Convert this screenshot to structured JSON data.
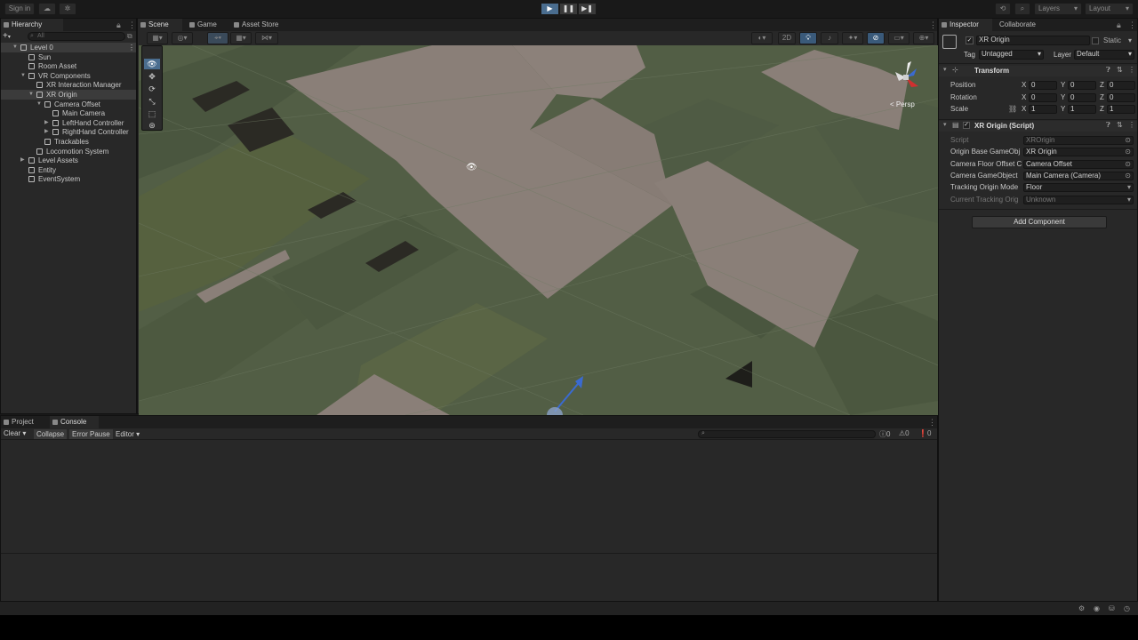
{
  "topbar": {
    "sign_in": "Sign in",
    "layers": "Layers",
    "layout": "Layout",
    "play": "▶",
    "pause": "❚❚",
    "step": "▶❚"
  },
  "hierarchy": {
    "tab": "Hierarchy",
    "search_placeholder": "All",
    "add": "+",
    "items": [
      {
        "label": "Level 0",
        "depth": 0
      },
      {
        "label": "Sun",
        "depth": 1
      },
      {
        "label": "Room Asset",
        "depth": 1
      },
      {
        "label": "VR Components",
        "depth": 1
      },
      {
        "label": "XR Interaction Manager",
        "depth": 2
      },
      {
        "label": "XR Origin",
        "depth": 2
      },
      {
        "label": "Camera Offset",
        "depth": 3
      },
      {
        "label": "Main Camera",
        "depth": 4
      },
      {
        "label": "LeftHand Controller",
        "depth": 4
      },
      {
        "label": "RightHand Controller",
        "depth": 4
      },
      {
        "label": "Trackables",
        "depth": 3
      },
      {
        "label": "Locomotion System",
        "depth": 2
      },
      {
        "label": "Level Assets",
        "depth": 1
      },
      {
        "label": "Entity",
        "depth": 1
      },
      {
        "label": "EventSystem",
        "depth": 1
      }
    ]
  },
  "scene": {
    "tabs": [
      "Scene",
      "Game",
      "Asset Store"
    ],
    "btn_2d": "2D",
    "persp": "< Persp"
  },
  "bottom": {
    "tabs": [
      "Project",
      "Console"
    ],
    "clear": "Clear",
    "collapse": "Collapse",
    "error_pause": "Error Pause",
    "editor": "Editor",
    "count_log": "0",
    "count_warn": "0",
    "count_err": "0"
  },
  "inspector": {
    "tabs": [
      "Inspector",
      "Collaborate"
    ],
    "object_name": "XR Origin",
    "static": "Static",
    "tag_label": "Tag",
    "tag_value": "Untagged",
    "layer_label": "Layer",
    "layer_value": "Default",
    "transform": {
      "title": "Transform",
      "position_label": "Position",
      "rotation_label": "Rotation",
      "scale_label": "Scale",
      "position": [
        "0",
        "0",
        "0"
      ],
      "rotation": [
        "0",
        "0",
        "0"
      ],
      "scale": [
        "1",
        "1",
        "1"
      ],
      "axis_x": "X",
      "axis_y": "Y",
      "axis_z": "Z"
    },
    "script_component": {
      "title": "XR Origin (Script)",
      "rows": [
        {
          "label": "Script",
          "value": "XROrigin",
          "dim": true
        },
        {
          "label": "Origin Base GameObj",
          "value": "XR Origin",
          "dim": false
        },
        {
          "label": "Camera Floor Offset C",
          "value": "Camera Offset",
          "dim": false
        },
        {
          "label": "Camera GameObject",
          "value": "Main Camera (Camera)",
          "dim": false
        },
        {
          "label": "Tracking Origin Mode",
          "value": "Floor",
          "dim": false
        },
        {
          "label": "Current Tracking Orig",
          "value": "Unknown",
          "dim": true
        }
      ]
    },
    "add_component": "Add Component"
  },
  "colors": {
    "accent": "#4a6d8f",
    "floor": "#8a7f78",
    "wall": "#4f5b44"
  }
}
